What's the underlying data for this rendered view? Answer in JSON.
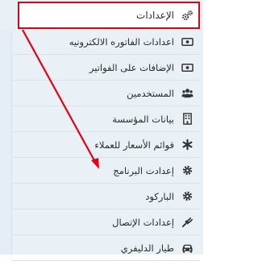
{
  "menu": {
    "header": {
      "label": "الإعدادات",
      "icon": "gears-icon"
    },
    "items": [
      {
        "label": "اعدادات الفاتوره الالكترونيه",
        "icon": "money-icon"
      },
      {
        "label": "الإضافات على الفواتير",
        "icon": "money-icon"
      },
      {
        "label": "المستخدمين",
        "icon": "users-icon"
      },
      {
        "label": "بيانات المؤسسة",
        "icon": "building-icon"
      },
      {
        "label": "قوائم الأسعار للعملاء",
        "icon": "asterisk-icon"
      },
      {
        "label": "إعدادت البرنامج",
        "icon": "gear-icon"
      },
      {
        "label": "الباركود",
        "icon": "gear-icon"
      },
      {
        "label": "إعدادات الإتصال",
        "icon": "plug-icon"
      },
      {
        "label": "طيار الدليفري",
        "icon": "car-icon"
      }
    ]
  },
  "annotation": {
    "color": "#e3000f"
  }
}
